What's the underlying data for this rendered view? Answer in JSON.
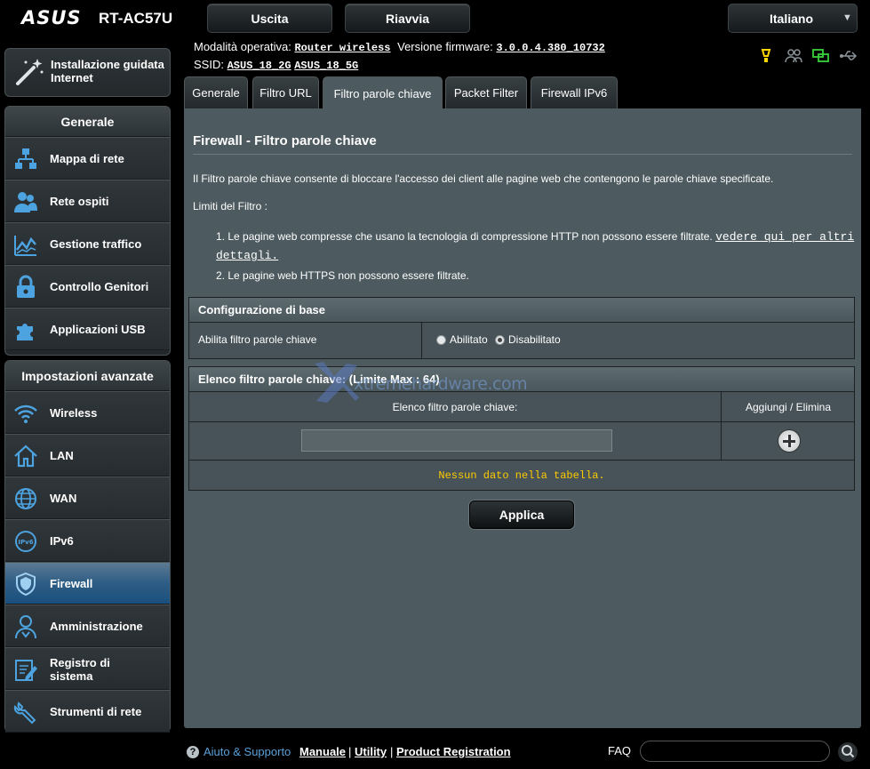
{
  "header": {
    "brand": "ASUS",
    "model": "RT-AC57U",
    "logout_label": "Uscita",
    "reboot_label": "Riavvia",
    "language": "Italiano"
  },
  "info": {
    "mode_label": "Modalità operativa:",
    "mode_value": "Router wireless",
    "firmware_label": "Versione firmware:",
    "firmware_value": "3.0.0.4.380_10732",
    "ssid_label": "SSID:",
    "ssid_2g": "ASUS_18_2G",
    "ssid_5g": "ASUS_18_5G"
  },
  "sidebar": {
    "quick_setup": "Installazione guidata Internet",
    "general_title": "Generale",
    "general_items": [
      {
        "label": "Mappa di rete",
        "icon": "network-map-icon"
      },
      {
        "label": "Rete ospiti",
        "icon": "guest-network-icon"
      },
      {
        "label": "Gestione traffico",
        "icon": "traffic-manager-icon"
      },
      {
        "label": "Controllo Genitori",
        "icon": "parental-lock-icon"
      },
      {
        "label": "Applicazioni USB",
        "icon": "usb-puzzle-icon"
      }
    ],
    "advanced_title": "Impostazioni avanzate",
    "advanced_items": [
      {
        "label": "Wireless",
        "icon": "wifi-icon"
      },
      {
        "label": "LAN",
        "icon": "home-icon"
      },
      {
        "label": "WAN",
        "icon": "globe-icon"
      },
      {
        "label": "IPv6",
        "icon": "ipv6-icon"
      },
      {
        "label": "Firewall",
        "icon": "shield-icon"
      },
      {
        "label": "Amministrazione",
        "icon": "admin-icon"
      },
      {
        "label": "Registro di sistema",
        "icon": "log-icon"
      },
      {
        "label": "Strumenti di rete",
        "icon": "tools-icon"
      }
    ]
  },
  "tabs": [
    "Generale",
    "Filtro URL",
    "Filtro parole chiave",
    "Packet Filter",
    "Firewall IPv6"
  ],
  "active_tab": 2,
  "content": {
    "title": "Firewall - Filtro parole chiave",
    "description": "Il Filtro parole chiave consente di bloccare l'accesso dei client alle pagine web che contengono le parole chiave specificate.",
    "limits_label": "Limiti del Filtro :",
    "limit_1": "1. Le pagine web compresse che usano la tecnologia di compressione HTTP non possono essere filtrate.",
    "limit_1_link": "vedere qui per altri dettagli.",
    "limit_2": "2. Le pagine web HTTPS non possono essere filtrate."
  },
  "basic_config": {
    "header": "Configurazione di base",
    "enable_label": "Abilita filtro parole chiave",
    "option_enabled": "Abilitato",
    "option_disabled": "Disabilitato",
    "selected": "Disabilitato"
  },
  "keyword_list": {
    "header": "Elenco filtro parole chiave: (Limite Max : 64)",
    "col_keyword": "Elenco filtro parole chiave:",
    "col_action": "Aggiungi / Elimina",
    "input_value": "",
    "empty_text": "Nessun dato nella tabella."
  },
  "apply_label": "Applica",
  "watermark": "xtremehardware.com",
  "footer": {
    "help": "Aiuto & Supporto",
    "manual": "Manuale",
    "utility": "Utility",
    "product_reg": "Product Registration",
    "faq": "FAQ",
    "separator": "|"
  },
  "colors": {
    "active_blue": "#1a4f7d",
    "panel": "#4d5a5f",
    "warning_text": "#ffcc00",
    "link_blue": "#5aa0d8"
  }
}
